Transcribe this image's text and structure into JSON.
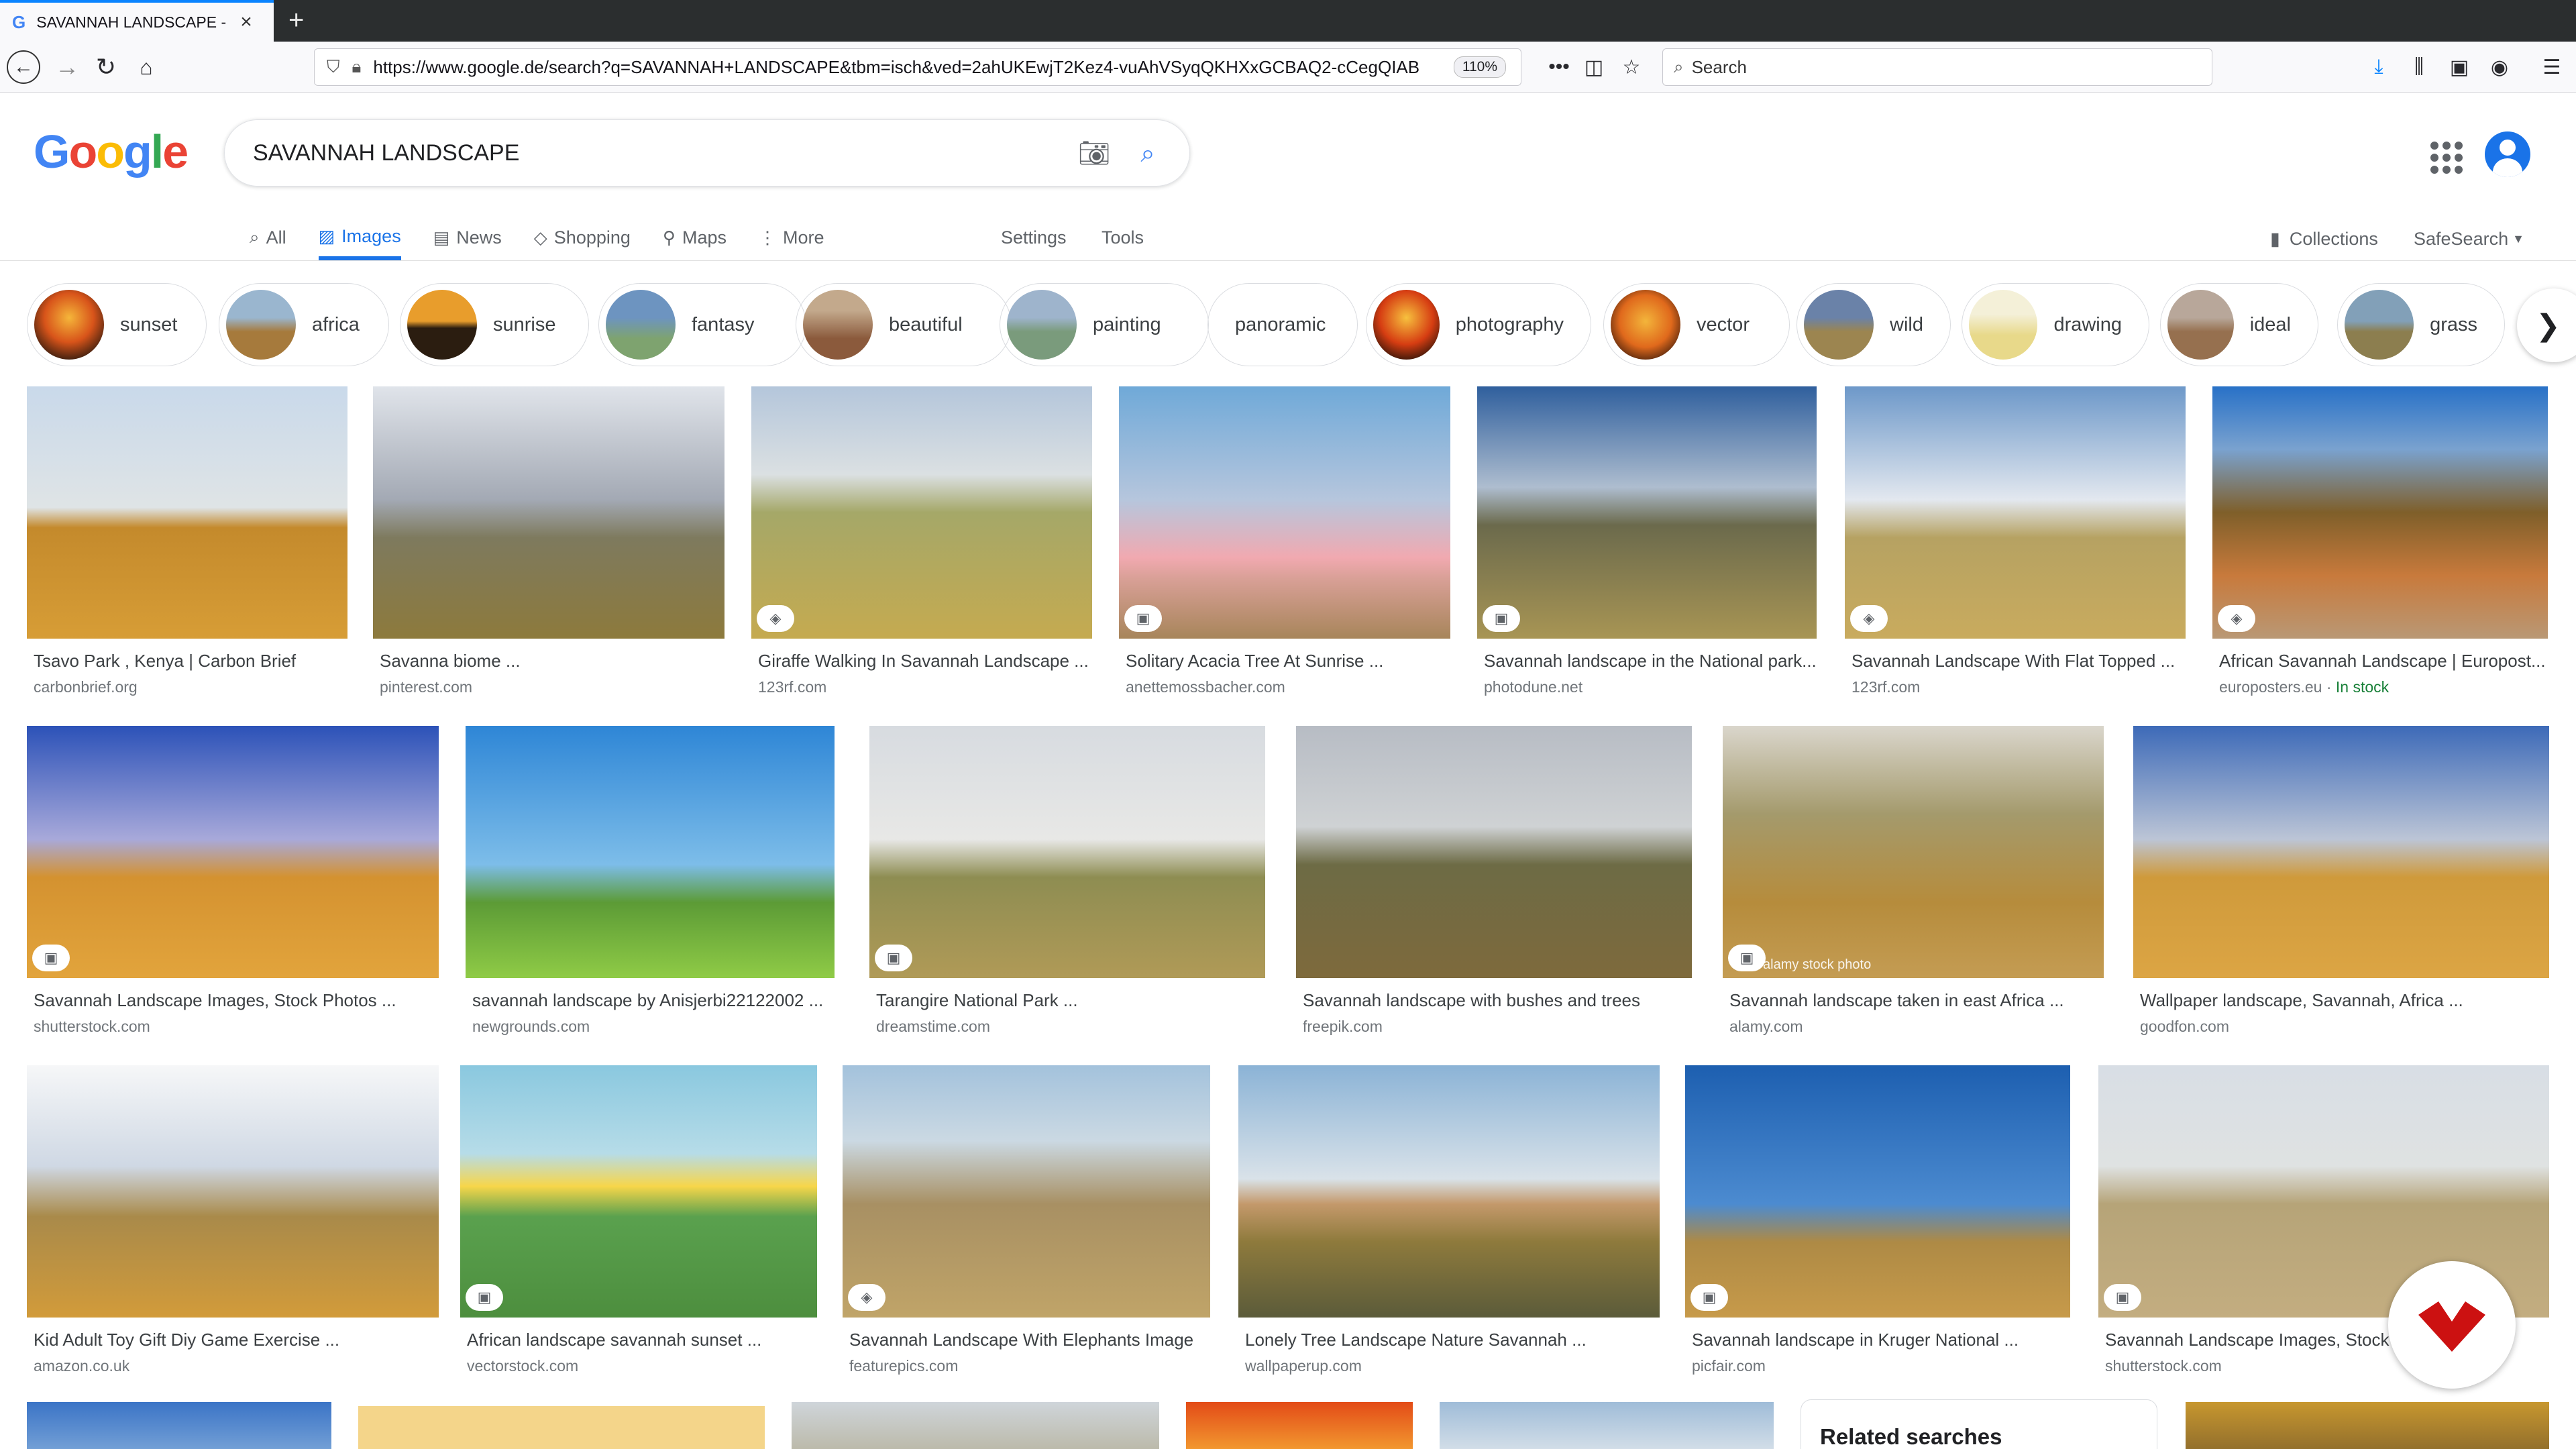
{
  "browser": {
    "tab_title": "SAVANNAH LANDSCAPE - Goo",
    "url": "https://www.google.de/search?q=SAVANNAH+LANDSCAPE&tbm=isch&ved=2ahUKEwjT2Kez4-vuAhVSyqQKHXxGCBAQ2-cCegQIAB",
    "zoom": "110%",
    "search_placeholder": "Search"
  },
  "google": {
    "logo": "Google",
    "query": "SAVANNAH LANDSCAPE",
    "tabs": [
      {
        "label": "All",
        "icon": "search-icon"
      },
      {
        "label": "Images",
        "icon": "image-icon"
      },
      {
        "label": "News",
        "icon": "news-icon"
      },
      {
        "label": "Shopping",
        "icon": "tag-icon"
      },
      {
        "label": "Maps",
        "icon": "map-pin-icon"
      },
      {
        "label": "More",
        "icon": "more-vert-icon"
      }
    ],
    "settings": "Settings",
    "tools": "Tools",
    "collections": "Collections",
    "safesearch": "SafeSearch"
  },
  "chips": [
    {
      "label": "sunset",
      "color": "#c4561b"
    },
    {
      "label": "africa",
      "color": "#a67a3c"
    },
    {
      "label": "sunrise",
      "color": "#2b1d10"
    },
    {
      "label": "fantasy",
      "color": "#7b97b1"
    },
    {
      "label": "beautiful",
      "color": "#8b5a3c"
    },
    {
      "label": "painting",
      "color": "#7a9b7c"
    },
    {
      "label": "panoramic",
      "color": ""
    },
    {
      "label": "photography",
      "color": "#d63d12"
    },
    {
      "label": "vector",
      "color": "#e0691c"
    },
    {
      "label": "wild",
      "color": "#6a82a8"
    },
    {
      "label": "drawing",
      "color": "#e8d98a"
    },
    {
      "label": "ideal",
      "color": "#96704f"
    },
    {
      "label": "grass",
      "color": "#82a0b8"
    }
  ],
  "results": [
    {
      "caption": "Tsavo Park , Kenya | Carbon Brief",
      "source": "carbonbrief.org",
      "badge": false
    },
    {
      "caption": "Savanna biome ...",
      "source": "pinterest.com",
      "badge": false
    },
    {
      "caption": "Giraffe Walking In Savannah Landscape ...",
      "source": "123rf.com",
      "badge": true
    },
    {
      "caption": "Solitary Acacia Tree At Sunrise ...",
      "source": "anettemossbacher.com",
      "badge": true
    },
    {
      "caption": "Savannah landscape in the National park...",
      "source": "photodune.net",
      "badge": true
    },
    {
      "caption": "Savannah Landscape With Flat Topped ...",
      "source": "123rf.com",
      "badge": true
    },
    {
      "caption": "African Savannah Landscape | Europost...",
      "source": "europosters.eu",
      "extra": "In stock",
      "badge": true
    },
    {
      "caption": "Savannah Landscape Images, Stock Photos ...",
      "source": "shutterstock.com",
      "badge": true
    },
    {
      "caption": "savannah landscape by Anisjerbi22122002 ...",
      "source": "newgrounds.com",
      "badge": false
    },
    {
      "caption": "Tarangire National Park ...",
      "source": "dreamstime.com",
      "badge": true
    },
    {
      "caption": "Savannah landscape with bushes and trees",
      "source": "freepik.com",
      "badge": false
    },
    {
      "caption": "Savannah landscape taken in east Africa ...",
      "source": "alamy.com",
      "badge": true,
      "watermark": "alamy stock photo"
    },
    {
      "caption": "Wallpaper landscape, Savannah, Africa ...",
      "source": "goodfon.com",
      "badge": false
    },
    {
      "caption": "Kid Adult Toy Gift Diy Game Exercise ...",
      "source": "amazon.co.uk",
      "badge": false
    },
    {
      "caption": "African landscape savannah sunset ...",
      "source": "vectorstock.com",
      "badge": true
    },
    {
      "caption": "Savannah Landscape With Elephants Image",
      "source": "featurepics.com",
      "badge": true
    },
    {
      "caption": "Lonely Tree Landscape Nature Savannah ...",
      "source": "wallpaperup.com",
      "badge": false
    },
    {
      "caption": "Savannah landscape in Kruger National ...",
      "source": "picfair.com",
      "badge": true
    },
    {
      "caption": "Savannah Landscape Images, Stock",
      "source": "shutterstock.com",
      "badge": true
    }
  ],
  "related": "Related searches"
}
